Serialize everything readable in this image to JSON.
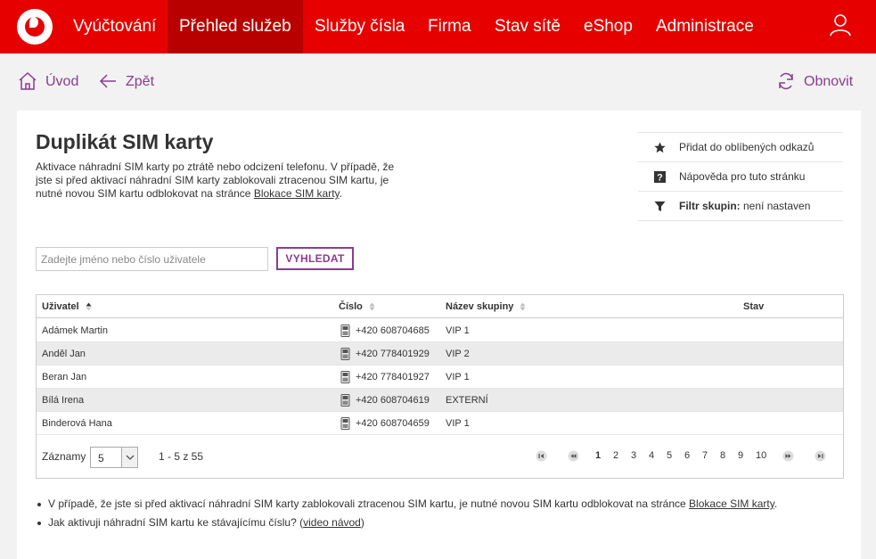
{
  "nav": {
    "items": [
      {
        "label": "Vyúčtování"
      },
      {
        "label": "Přehled služeb"
      },
      {
        "label": "Služby čísla"
      },
      {
        "label": "Firma"
      },
      {
        "label": "Stav sítě"
      },
      {
        "label": "eShop"
      },
      {
        "label": "Administrace"
      }
    ]
  },
  "toolbar": {
    "home": "Úvod",
    "back": "Zpět",
    "refresh": "Obnovit"
  },
  "page": {
    "title": "Duplikát SIM karty",
    "description": "Aktivace náhradní SIM karty po ztrátě nebo odcizení telefonu. V případě, že jste si před aktivací náhradní SIM karty zablokovali ztracenou SIM kartu, je nutné novou SIM kartu odblokovat na stránce ",
    "description_link": "Blokace SIM karty",
    "description_end": "."
  },
  "side": {
    "favorites": "Přidat do oblíbených odkazů",
    "help": "Nápověda pro tuto stránku",
    "filter_label": "Filtr skupin:",
    "filter_value": " není nastaven"
  },
  "search": {
    "placeholder": "Zadejte jméno nebo číslo uživatele",
    "button": "VYHLEDAT"
  },
  "table": {
    "headers": {
      "user": "Uživatel",
      "number": "Číslo",
      "group": "Název skupiny",
      "status": "Stav"
    },
    "rows": [
      {
        "user": "Adámek Martin",
        "number": "+420 608704685",
        "group": "VIP 1",
        "status": ""
      },
      {
        "user": "Anděl Jan",
        "number": "+420 778401929",
        "group": "VIP 2",
        "status": ""
      },
      {
        "user": "Beran Jan",
        "number": "+420 778401927",
        "group": "VIP 1",
        "status": ""
      },
      {
        "user": "Bílá Irena",
        "number": "+420 608704619",
        "group": "EXTERNÍ",
        "status": ""
      },
      {
        "user": "Binderová Hana",
        "number": "+420 608704659",
        "group": "VIP 1",
        "status": ""
      }
    ],
    "records_label": "Záznamy",
    "page_size": "5",
    "range": "1 - 5 z 55",
    "pages": [
      "1",
      "2",
      "3",
      "4",
      "5",
      "6",
      "7",
      "8",
      "9",
      "10"
    ],
    "current_page": "1"
  },
  "notes": {
    "note1": "V případě, že jste si před aktivací náhradní SIM karty zablokovali ztracenou SIM kartu, je nutné novou SIM kartu odblokovat na stránce ",
    "note1_link": "Blokace SIM karty",
    "note1_end": ".",
    "note2": "Jak aktivuji náhradní SIM kartu ke stávajícímu číslu? (",
    "note2_link": "video návod",
    "note2_end": ")"
  },
  "colors": {
    "brand": "#e60000",
    "active_nav": "#b80000",
    "accent": "#8b3b8f"
  }
}
